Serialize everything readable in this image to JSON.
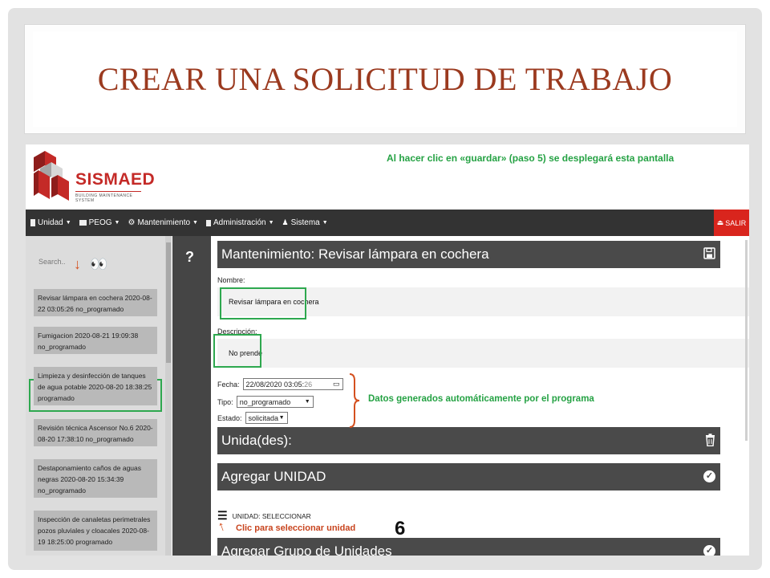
{
  "slide": {
    "title": "CREAR UNA SOLICITUD DE TRABAJO"
  },
  "app": {
    "logo_text": "SISMAED",
    "logo_subtitle": "BUILDING MAINTENANCE SYSTEM",
    "top_note": "Al hacer clic en «guardar» (paso 5) se desplegará esta pantalla"
  },
  "navbar": {
    "items": [
      {
        "label": "Unidad",
        "icon": "building-icon"
      },
      {
        "label": "PEOG",
        "icon": "calendar-icon"
      },
      {
        "label": "Mantenimiento",
        "icon": "gears-icon"
      },
      {
        "label": "Administración",
        "icon": "book-icon"
      },
      {
        "label": "Sistema",
        "icon": "users-icon"
      }
    ],
    "logout_label": "SALIR"
  },
  "sidebar": {
    "search_placeholder": "Search..",
    "items": [
      {
        "text": "Revisar lámpara en cochera 2020-08-22 03:05:26 no_programado"
      },
      {
        "text": "Fumigacion 2020-08-21 19:09:38 no_programado"
      },
      {
        "text": "Limpieza y desinfección de tanques de agua potable 2020-08-20 18:38:25 programado"
      },
      {
        "text": "Revisión técnica Ascensor No.6 2020-08-20 17:38:10 no_programado"
      },
      {
        "text": "Destaponamiento caños de aguas negras 2020-08-20 15:34:39 no_programado"
      },
      {
        "text": "Inspección de canaletas perimetrales pozos pluviales y cloacales 2020-08-19 18:25:00 programado"
      }
    ]
  },
  "help_label": "?",
  "form": {
    "header_title": "Mantenimiento: Revisar lámpara en cochera",
    "nombre_label": "Nombre:",
    "nombre_value": "Revisar lámpara en cochera",
    "descripcion_label": "Descripción:",
    "descripcion_value": "No prende",
    "fecha_label": "Fecha:",
    "fecha_value": "22/08/2020 03:05:",
    "fecha_seconds": "26",
    "tipo_label": "Tipo:",
    "tipo_value": "no_programado",
    "estado_label": "Estado:",
    "estado_value": "solicitada",
    "auto_note": "Datos generados automáticamente por el programa",
    "unidades_header": "Unida(des):",
    "agregar_unidad_header": "Agregar UNIDAD",
    "unidad_select_label": "UNIDAD: SELECCIONAR",
    "click_note": "Clic para seleccionar unidad",
    "step_number": "6",
    "agregar_grupo_header": "Agregar Grupo de Unidades"
  },
  "colors": {
    "title": "#9b3a1f",
    "note_green": "#25a244",
    "navbar": "#333333",
    "header": "#4a4a4a",
    "logout": "#d9251d"
  }
}
